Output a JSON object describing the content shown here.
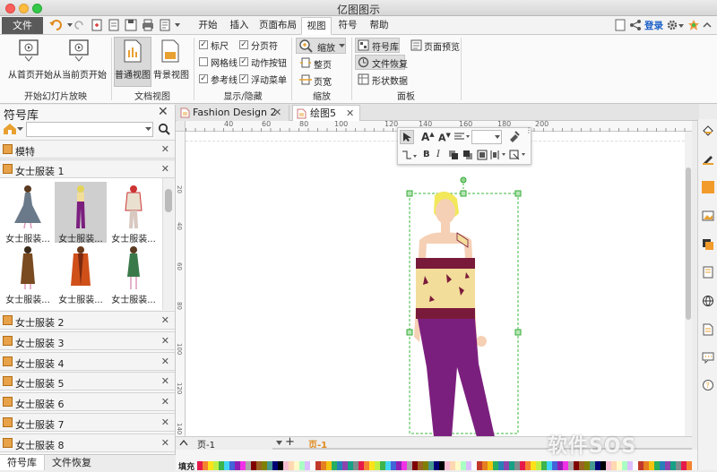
{
  "app": {
    "title": "亿图图示"
  },
  "menu": {
    "file": "文件",
    "tabs": [
      "开始",
      "插入",
      "页面布局",
      "视图",
      "符号",
      "帮助"
    ],
    "active_tab": "视图",
    "login": "登录"
  },
  "ribbon": {
    "slideshow": {
      "from_first": "从首页开始",
      "from_current": "从当前页开始",
      "group": "开始幻灯片放映"
    },
    "docview": {
      "normal": "普通视图",
      "background": "背景视图",
      "group": "文档视图"
    },
    "showhide": {
      "ruler": "标尺",
      "pagebreak": "分页符",
      "grid": "网格线",
      "actionbtn": "动作按钮",
      "guides": "参考线",
      "floatmenu": "浮动菜单",
      "group": "显示/隐藏"
    },
    "zoom": {
      "zoom": "缩放",
      "fullpage": "整页",
      "pagewidth": "页宽",
      "group": "缩放"
    },
    "panel": {
      "library": "符号库",
      "preview": "页面预览",
      "recovery": "文件恢复",
      "shapedata": "形状数据",
      "group": "面板"
    }
  },
  "library": {
    "title": "符号库",
    "categories_top": [
      "模特",
      "女士服装 1"
    ],
    "items": [
      "女士服装...",
      "女士服装...",
      "女士服装...",
      "女士服装...",
      "女士服装...",
      "女士服装..."
    ],
    "categories_bottom": [
      "女士服装 2",
      "女士服装 3",
      "女士服装 4",
      "女士服装 5",
      "女士服装 6",
      "女士服装 7",
      "女士服装 8"
    ],
    "bottom_tabs": [
      "符号库",
      "文件恢复"
    ]
  },
  "doc_tabs": [
    "Fashion Design 2",
    "绘图5"
  ],
  "active_doc": "绘图5",
  "rulers": {
    "h": [
      "40",
      "60",
      "80",
      "100",
      "120",
      "140",
      "160",
      "180",
      "200"
    ],
    "v": [
      "20",
      "40",
      "60",
      "80",
      "100",
      "120",
      "140"
    ]
  },
  "pagebar": {
    "page": "页-1",
    "current": "页-1"
  },
  "colorbar": {
    "fill": "填充"
  },
  "watermark": "软件SOS",
  "colors": {
    "accent": "#3a7bd5",
    "file_btn": "#5a5a5a",
    "pants": "#7b1f7e",
    "top": "#f3dd9a",
    "band": "#7a1a3a",
    "hair": "#f2e85a",
    "skin": "#f5d0b5"
  }
}
